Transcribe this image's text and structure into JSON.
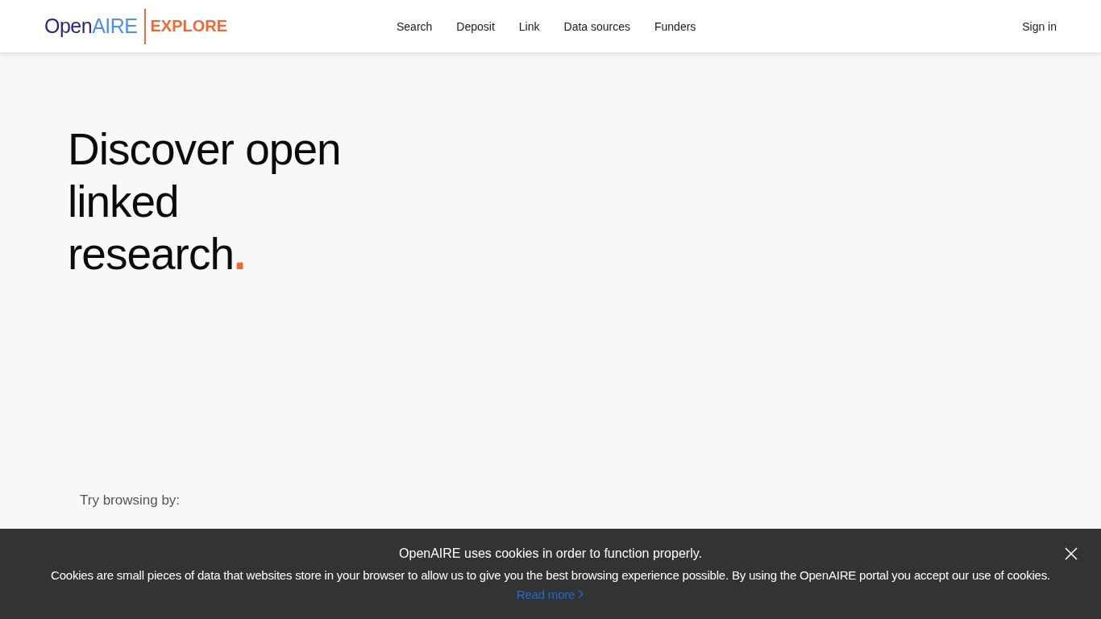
{
  "header": {
    "logo": {
      "open": "Open",
      "aire": "AIRE",
      "product": "EXPLORE"
    },
    "nav": [
      {
        "label": "Search"
      },
      {
        "label": "Deposit"
      },
      {
        "label": "Link"
      },
      {
        "label": "Data sources"
      },
      {
        "label": "Funders"
      }
    ],
    "sign_in": "Sign in"
  },
  "hero": {
    "lines": [
      "Discover open",
      "linked",
      "research"
    ],
    "accent": "."
  },
  "browse": {
    "label": "Try browsing by:"
  },
  "cookie_banner": {
    "title": "OpenAIRE uses cookies in order to function properly.",
    "text": "Cookies are small pieces of data that websites store in your browser to allow us to give you the best browsing experience possible. By using the OpenAIRE portal you accept our use of cookies.",
    "link": "Read more"
  }
}
